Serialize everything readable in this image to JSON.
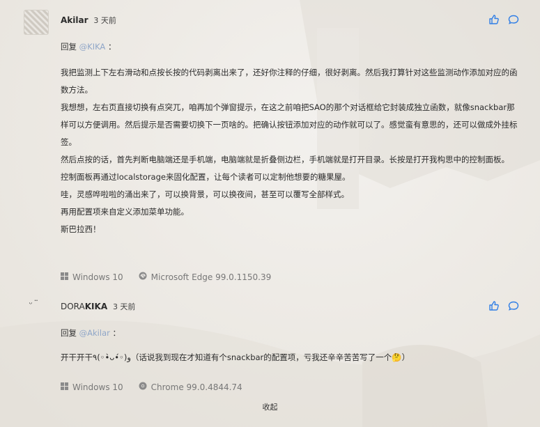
{
  "comments": [
    {
      "author": "Akilar",
      "time": "3 天前",
      "reply_prefix": "回复",
      "mention": "@KIKA",
      "reply_suffix": "：",
      "paragraphs": [
        "我把监测上下左右滑动和点按长按的代码剥离出来了，还好你注释的仔细，很好剥离。然后我打算针对这些监测动作添加对应的函数方法。",
        "我想想，左右页直接切换有点突兀，咱再加个弹窗提示，在这之前咱把SAO的那个对话框给它封装成独立函数，就像snackbar那样可以方便调用。然后提示是否需要切换下一页啥的。把确认按钮添加对应的动作就可以了。感觉蛮有意思的，还可以做成外挂标签。",
        "然后点按的话，首先判断电脑端还是手机端，电脑端就是折叠侧边栏，手机端就是打开目录。长按是打开我构思中的控制面板。",
        "控制面板再通过localstorage来固化配置，让每个读者可以定制他想要的糖果屋。",
        "哇，灵感哗啦啦的涌出来了，可以换背景，可以换夜间，甚至可以覆写全部样式。",
        "再用配置项来自定义添加菜单功能。",
        "斯巴拉西！"
      ],
      "os": "Windows 10",
      "browser": "Microsoft Edge 99.0.1150.39"
    },
    {
      "author_prefix": "DORA",
      "author_main": "KIKA",
      "avatar_face": "ᵕ̈",
      "time": "3 天前",
      "reply_prefix": "回复",
      "mention": "@Akilar",
      "reply_suffix": "：",
      "paragraphs": [
        "开干开干٩(◦•̀ᴗ•́◦)و（话说我到现在才知道有个snackbar的配置项，亏我还辛辛苦苦写了一个🤔）"
      ],
      "os": "Windows 10",
      "browser": "Chrome 99.0.4844.74"
    }
  ],
  "collapse_label": "收起",
  "icons": {
    "like": "thumbs-up-icon",
    "reply": "chat-bubble-icon",
    "os": "windows-icon",
    "browser_edge": "edge-icon",
    "browser_chrome": "chrome-icon"
  },
  "colors": {
    "accent": "#2f7ee6",
    "mention": "#8fa6c8",
    "muted": "#777777"
  }
}
